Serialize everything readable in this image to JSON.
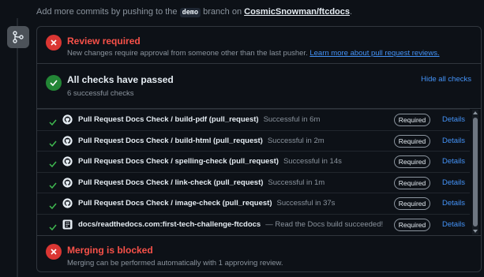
{
  "hint": {
    "prefix": "Add more commits by pushing to the",
    "branch": "demo",
    "middle": "branch on",
    "repo": "CosmicSnowman/ftcdocs",
    "suffix": "."
  },
  "review": {
    "title": "Review required",
    "subtitle": "New changes require approval from someone other than the last pusher.",
    "link": "Learn more about pull request reviews."
  },
  "checks": {
    "title": "All checks have passed",
    "subtitle": "6 successful checks",
    "hide_link": "Hide all checks",
    "items": [
      {
        "name": "Pull Request Docs Check / build-pdf (pull_request)",
        "status": "Successful in 6m",
        "badge": "Required",
        "details": "Details",
        "icon": "github-icon"
      },
      {
        "name": "Pull Request Docs Check / build-html (pull_request)",
        "status": "Successful in 2m",
        "badge": "Required",
        "details": "Details",
        "icon": "github-icon"
      },
      {
        "name": "Pull Request Docs Check / spelling-check (pull_request)",
        "status": "Successful in 14s",
        "badge": "Required",
        "details": "Details",
        "icon": "github-icon"
      },
      {
        "name": "Pull Request Docs Check / link-check (pull_request)",
        "status": "Successful in 1m",
        "badge": "Required",
        "details": "Details",
        "icon": "github-icon"
      },
      {
        "name": "Pull Request Docs Check / image-check (pull_request)",
        "status": "Successful in 37s",
        "badge": "Required",
        "details": "Details",
        "icon": "github-icon"
      },
      {
        "name": "docs/readthedocs.com:first-tech-challenge-ftcdocs",
        "status": "— Read the Docs build succeeded!",
        "badge": "Required",
        "details": "Details",
        "icon": "readthedocs-icon"
      }
    ]
  },
  "blocked": {
    "title": "Merging is blocked",
    "subtitle": "Merging can be performed automatically with 1 approving review."
  }
}
